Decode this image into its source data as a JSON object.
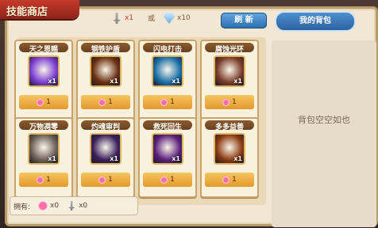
{
  "window": {
    "title": "技能商店"
  },
  "cost": {
    "sword_count": "x1",
    "separator": "或",
    "gem_count": "x10"
  },
  "buttons": {
    "refresh": "刷 新",
    "bag_tab": "我的背包"
  },
  "bag": {
    "empty_text": "背包空空如也"
  },
  "owned": {
    "label": "拥有:",
    "heart_count": "x0",
    "sword_count": "x0"
  },
  "items": [
    {
      "name": "天之恩赐",
      "qty": "x1",
      "price": "1",
      "icon": "purple-orb-icon",
      "color": "#7b3fd1"
    },
    {
      "name": "钢铁护盾",
      "qty": "x1",
      "price": "1",
      "icon": "golden-shield-icon",
      "color": "#6a2f10"
    },
    {
      "name": "闪电打击",
      "qty": "x1",
      "price": "1",
      "icon": "lightning-icon",
      "color": "#1a6ea8"
    },
    {
      "name": "腐蚀光环",
      "qty": "x1",
      "price": "1",
      "icon": "corrosion-warrior-icon",
      "color": "#7a3b28"
    },
    {
      "name": "万物凋零",
      "qty": "x1",
      "price": "1",
      "icon": "wither-sword-icon",
      "color": "#6b5f58"
    },
    {
      "name": "灼魂审判",
      "qty": "x1",
      "price": "1",
      "icon": "purple-slash-icon",
      "color": "#3a1f5a"
    },
    {
      "name": "救死回生",
      "qty": "x1",
      "price": "1",
      "icon": "revive-orb-icon",
      "color": "#5a1f7a"
    },
    {
      "name": "多多益善",
      "qty": "x1",
      "price": "1",
      "icon": "fire-warrior-icon",
      "color": "#8b3a12"
    }
  ]
}
